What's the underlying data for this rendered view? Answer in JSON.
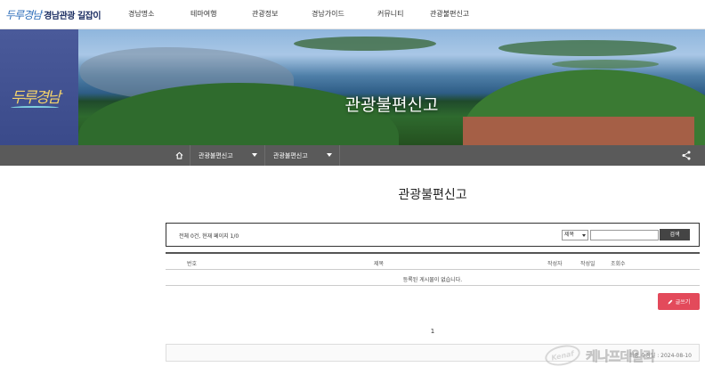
{
  "header": {
    "logo_mark": "두루경남",
    "logo_text": "경남관광 길잡이",
    "menu": [
      {
        "label": "경남명소"
      },
      {
        "label": "테마여행"
      },
      {
        "label": "관광정보"
      },
      {
        "label": "경남가이드"
      },
      {
        "label": "커뮤니티"
      },
      {
        "label": "관광불편신고"
      }
    ]
  },
  "hero": {
    "side_logo": "두루경남",
    "title": "관광불편신고"
  },
  "breadcrumb": {
    "items": [
      {
        "label": "관광불편신고"
      },
      {
        "label": "관광불편신고"
      }
    ]
  },
  "main": {
    "title": "관광불편신고",
    "search": {
      "count_text": "전체 0건, 현재 페이지 1/0",
      "select_value": "제목",
      "input_value": "",
      "button_label": "검색"
    },
    "table": {
      "columns": [
        "번호",
        "제목",
        "작성자",
        "작성일",
        "조회수"
      ],
      "empty_message": "등록된 게시물이 없습니다."
    },
    "write_button": "글쓰기",
    "pagination": [
      "1"
    ],
    "info_text": "최종 수정일 : 2024-08-10"
  },
  "watermark": {
    "logo": "Kenaf",
    "text": "케나프데일리"
  },
  "colors": {
    "breadcrumb_bg": "#5a5a5a",
    "hero_side": "#3a4a8a",
    "write_button": "#e34a5b",
    "search_button": "#444444"
  }
}
